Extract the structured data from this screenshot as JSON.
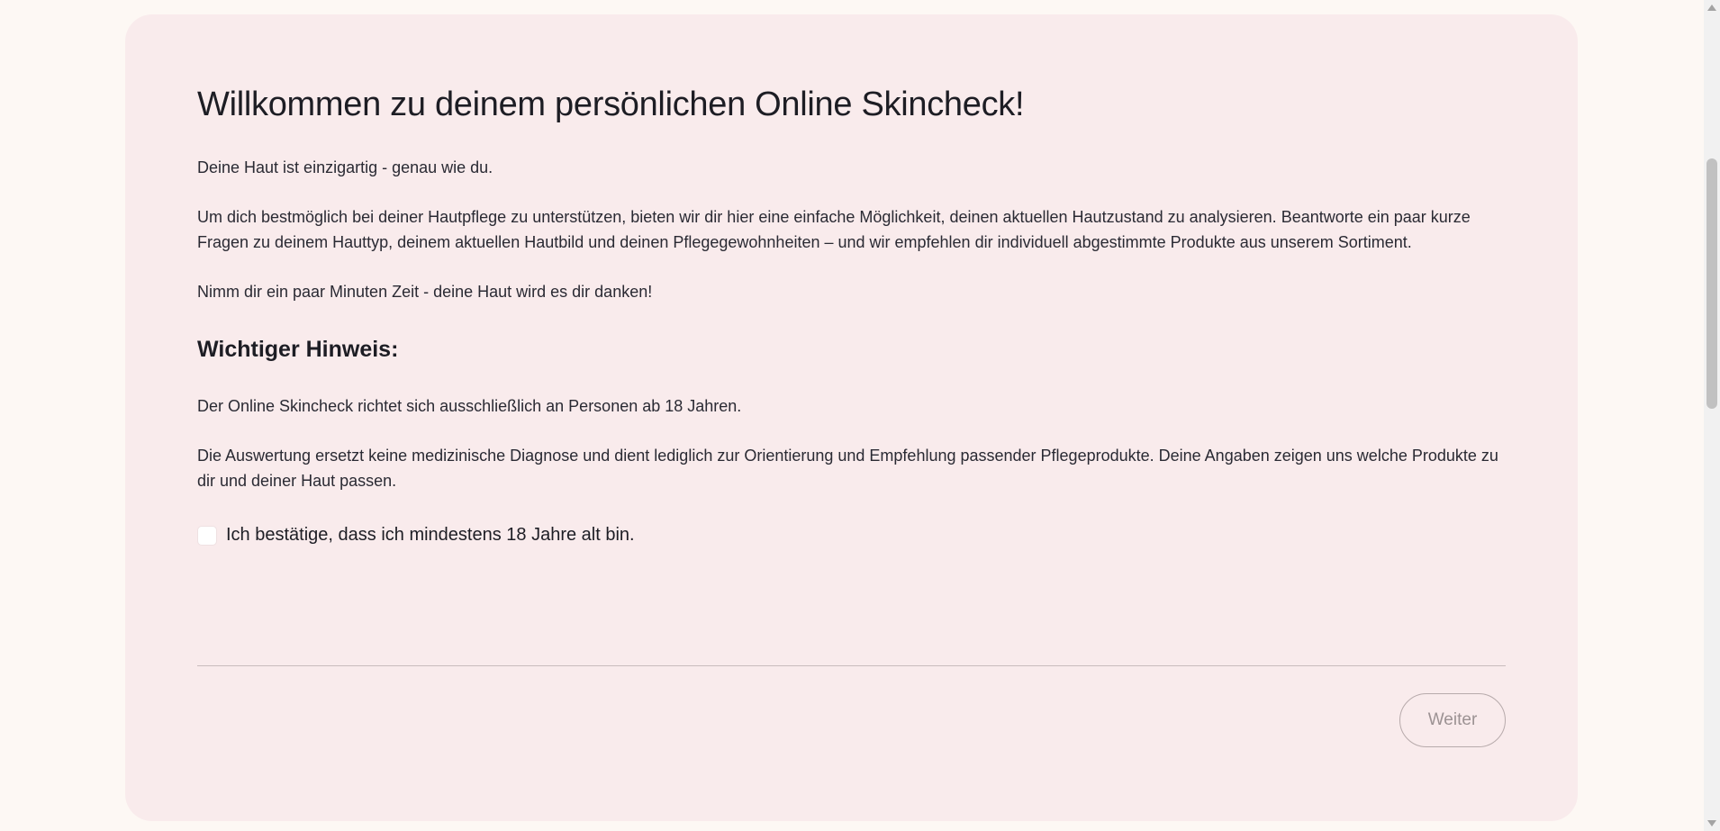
{
  "intro": {
    "title": "Willkommen zu deinem persönlichen Online Skincheck!",
    "tagline": "Deine Haut ist einzigartig - genau wie du.",
    "description": "Um dich bestmöglich bei deiner Hautpflege zu unterstützen, bieten wir dir hier eine einfache Möglichkeit, deinen aktuellen Hautzustand zu analysieren. Beantworte ein paar kurze Fragen zu deinem Hauttyp, deinem aktuellen Hautbild und deinen Pflegegewohnheiten – und wir empfehlen dir individuell abgestimmte Produkte aus unserem Sortiment.",
    "time_note": "Nimm dir ein paar Minuten Zeit - deine Haut wird es dir danken!"
  },
  "notice": {
    "heading": "Wichtiger Hinweis:",
    "age_text": "Der Online Skincheck richtet sich ausschließlich an Personen ab 18 Jahren.",
    "disclaimer": "Die Auswertung ersetzt keine medizinische Diagnose und dient lediglich zur Orientierung und Empfehlung passender Pflegeprodukte. Deine Angaben zeigen uns welche Produkte zu dir und deiner Haut passen."
  },
  "age_confirmation": {
    "label": "Ich bestätige, dass ich mindestens 18 Jahre alt bin.",
    "checked": false
  },
  "footer": {
    "next_label": "Weiter"
  },
  "colors": {
    "page_background": "#fdf8f4",
    "card_background": "#f9ebec",
    "text": "#1d1d24",
    "disabled_text": "#9c9293"
  }
}
